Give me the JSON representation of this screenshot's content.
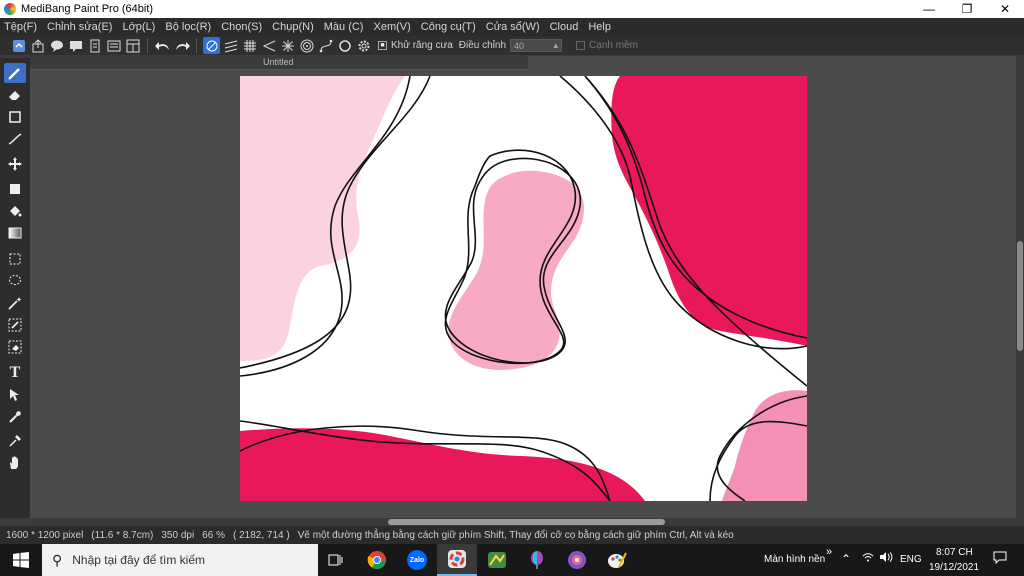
{
  "window": {
    "title": "MediBang Paint Pro (64bit)",
    "minimize": "—",
    "restore": "❐",
    "close": "✕"
  },
  "menu": [
    "Tệp(F)",
    "Chỉnh sửa(E)",
    "Lớp(L)",
    "Bộ lọc(R)",
    "Chọn(S)",
    "Chụp(N)",
    "Màu (C)",
    "Xem(V)",
    "Công cụ(T)",
    "Cửa sổ(W)",
    "Cloud",
    "Help"
  ],
  "toolbar": {
    "antialias_label": "Khử răng cưa",
    "adjust_label": "Điều chỉnh",
    "adjust_value": "40",
    "smooth_edge_label": "Cạnh mềm"
  },
  "document": {
    "tab_title": "Untitled"
  },
  "colors": {
    "accent_pink": "#e8185a",
    "light_pink": "#f7a9c6",
    "pale_pink": "#fbd3df",
    "canvas": "#ffffff",
    "active_tool": "#3d6fc9"
  },
  "status": {
    "size": "1600 * 1200 pixel",
    "physical": "(11.6 * 8.7cm)",
    "dpi": "350 dpi",
    "zoom": "66 %",
    "cursor": "( 2182, 714 )",
    "hint": "Vẽ một đường thẳng bằng cách giữ phím Shift, Thay đổi cỡ cọ bằng cách giữ phím Ctrl, Alt và kéo"
  },
  "taskbar": {
    "search_placeholder": "Nhập tại đây để tìm kiếm",
    "desktop_label": "Màn hình nền",
    "language": "ENG",
    "time": "8:07 CH",
    "date": "19/12/2021",
    "apps": [
      "task-view-icon",
      "chrome-icon",
      "zalo-icon",
      "medibang-icon",
      "game-icon",
      "balloon-icon",
      "app-icon",
      "paint-icon"
    ],
    "zalo_label": "Zalo"
  }
}
